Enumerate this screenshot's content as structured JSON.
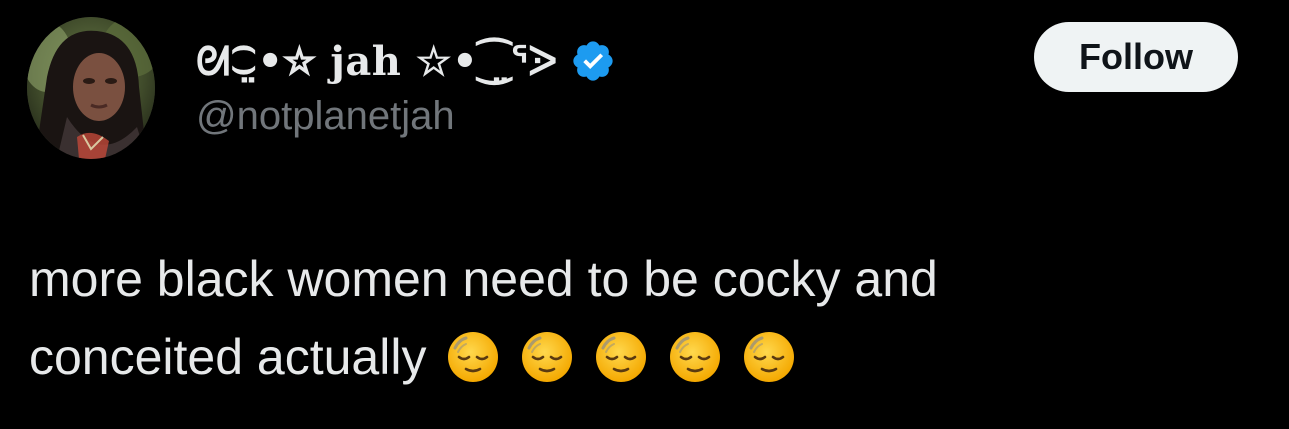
{
  "user": {
    "display_name": "ᘛ⁐̤•☆ jah ☆•⁐̤ᕐᐷ",
    "handle": "@notplanetjah",
    "verified": true,
    "verified_color": "#1d9bf0"
  },
  "actions": {
    "follow_label": "Follow"
  },
  "tweet": {
    "line1": "more black women need to be cocky and",
    "line2": "conceited actually",
    "emoji": [
      "pensive-face-emoji",
      "pensive-face-emoji",
      "pensive-face-emoji",
      "pensive-face-emoji",
      "pensive-face-emoji"
    ]
  },
  "colors": {
    "background": "#000000",
    "text_primary": "#e7e9ea",
    "text_secondary": "#71767b",
    "button_bg": "#eff3f4",
    "button_text": "#0f1419"
  }
}
